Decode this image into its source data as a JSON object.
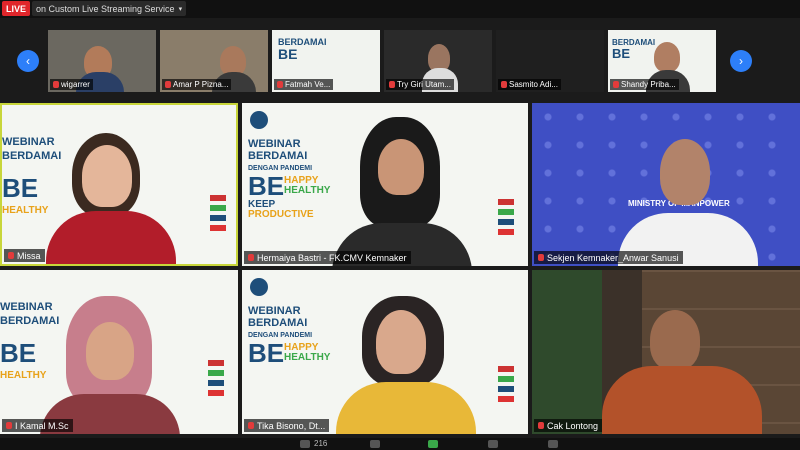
{
  "topbar": {
    "live_label": "LIVE",
    "stream_label": "on Custom Live Streaming Service"
  },
  "strip": {
    "prev_icon": "chevron-left-icon",
    "next_icon": "chevron-right-icon",
    "thumbs": [
      {
        "name": "wigarrer"
      },
      {
        "name": "Amar P Pizna..."
      },
      {
        "name": "Fatmah Ve..."
      },
      {
        "name": "Try Giri Utam..."
      },
      {
        "name": "Sasmito Adi..."
      },
      {
        "name": "Shandy Priba..."
      }
    ]
  },
  "tiles": [
    {
      "name": "Missa"
    },
    {
      "name": "Hermaiya Bastri - FK.CMV Kemnaker"
    },
    {
      "name": "Sekjen Kemnaker_Anwar Sanusi"
    },
    {
      "name": "I Kamal M.Sc"
    },
    {
      "name": "Tika Bisono, Dt..."
    },
    {
      "name": "Cak Lontong"
    }
  ],
  "poster": {
    "line1": "WEBINAR",
    "line2": "BERDAMAI",
    "line3": "DENGAN PANDEMI",
    "line4": "BE",
    "line5": "HAPPY",
    "line6": "HEALTHY",
    "line7": "KEEP",
    "line8": "PRODUCTIVE",
    "ministry": "MINISTRY OF MANPOWER"
  },
  "bottom": {
    "participants_count": "216"
  },
  "colors": {
    "live": "#e0262b",
    "nav": "#2d7ff9",
    "poster_blue": "#1e4e7a",
    "poster_orange": "#e8a21a",
    "poster_green": "#3aa84a",
    "ministry_bg": "#3f4fc4"
  }
}
